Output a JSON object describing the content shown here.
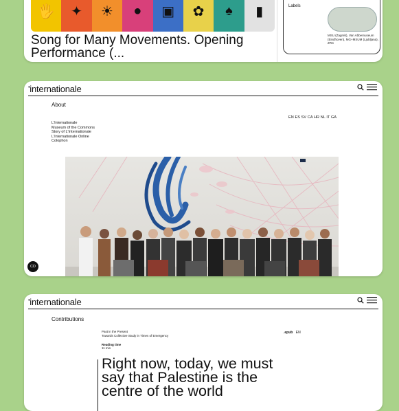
{
  "card1": {
    "headline": "Song for Many Movements. Opening Performance (...",
    "side_label": "Labels",
    "side_caption": "MSU (Zagreb), Van Abbemuseum (Eindhoven), MG+MSUM (Ljubljana), ZRC"
  },
  "site": {
    "logo": "'internationale",
    "icons": [
      "search-icon",
      "menu-icon"
    ]
  },
  "about_page": {
    "title": "About",
    "nav_items": [
      "L'Internationale",
      "Museum of the Commons",
      "Story of L'Internationale",
      "L'Internationale Online",
      "Colophon"
    ],
    "languages": "EN ES SV CA HR NL IT GA",
    "cookie_button": "CD"
  },
  "contributions_page": {
    "title": "Contributions",
    "series_line1": "Past in the Present",
    "series_line2": "Towards Collective Study in Times of Emergency",
    "reading_time_label": "Reading time",
    "reading_time_value": "11 min",
    "format_epub": ".epub",
    "format_lang": "EN",
    "quote": "Right now, today, we must say that Palestine is the centre of the world"
  },
  "colors": {
    "background": "#a9d28a",
    "card": "#ffffff",
    "text": "#111111"
  }
}
